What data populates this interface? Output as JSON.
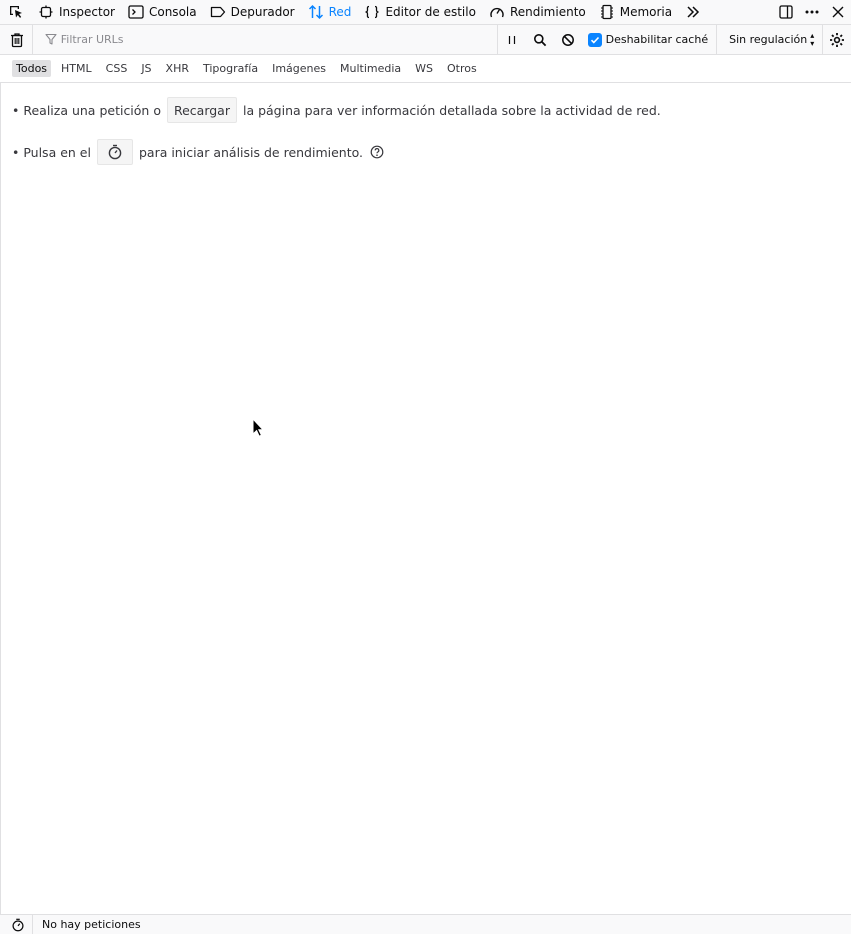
{
  "toolbox": {
    "tabs": [
      {
        "label": "Inspector",
        "icon": "inspector-icon",
        "selected": false
      },
      {
        "label": "Consola",
        "icon": "console-icon",
        "selected": false
      },
      {
        "label": "Depurador",
        "icon": "debugger-icon",
        "selected": false
      },
      {
        "label": "Red",
        "icon": "network-icon",
        "selected": true
      },
      {
        "label": "Editor de estilo",
        "icon": "style-editor-icon",
        "selected": false
      },
      {
        "label": "Rendimiento",
        "icon": "performance-icon",
        "selected": false
      },
      {
        "label": "Memoria",
        "icon": "memory-icon",
        "selected": false
      }
    ],
    "accent_color": "#0a84ff"
  },
  "filter_toolbar": {
    "search_placeholder": "Filtrar URLs",
    "disable_cache_label": "Deshabilitar caché",
    "disable_cache_checked": true,
    "throttling_label": "Sin regulación"
  },
  "request_types": [
    {
      "label": "Todos",
      "active": true
    },
    {
      "label": "HTML",
      "active": false
    },
    {
      "label": "CSS",
      "active": false
    },
    {
      "label": "JS",
      "active": false
    },
    {
      "label": "XHR",
      "active": false
    },
    {
      "label": "Tipografía",
      "active": false
    },
    {
      "label": "Imágenes",
      "active": false
    },
    {
      "label": "Multimedia",
      "active": false
    },
    {
      "label": "WS",
      "active": false
    },
    {
      "label": "Otros",
      "active": false
    }
  ],
  "empty_notice": {
    "reload_prefix": "• Realiza una petición o",
    "reload_button": "Recargar",
    "reload_suffix": "la página para ver información detallada sobre la actividad de red.",
    "perf_prefix": "• Pulsa en el",
    "perf_suffix": "para iniciar análisis de rendimiento."
  },
  "status_bar": {
    "summary": "No hay peticiones"
  }
}
